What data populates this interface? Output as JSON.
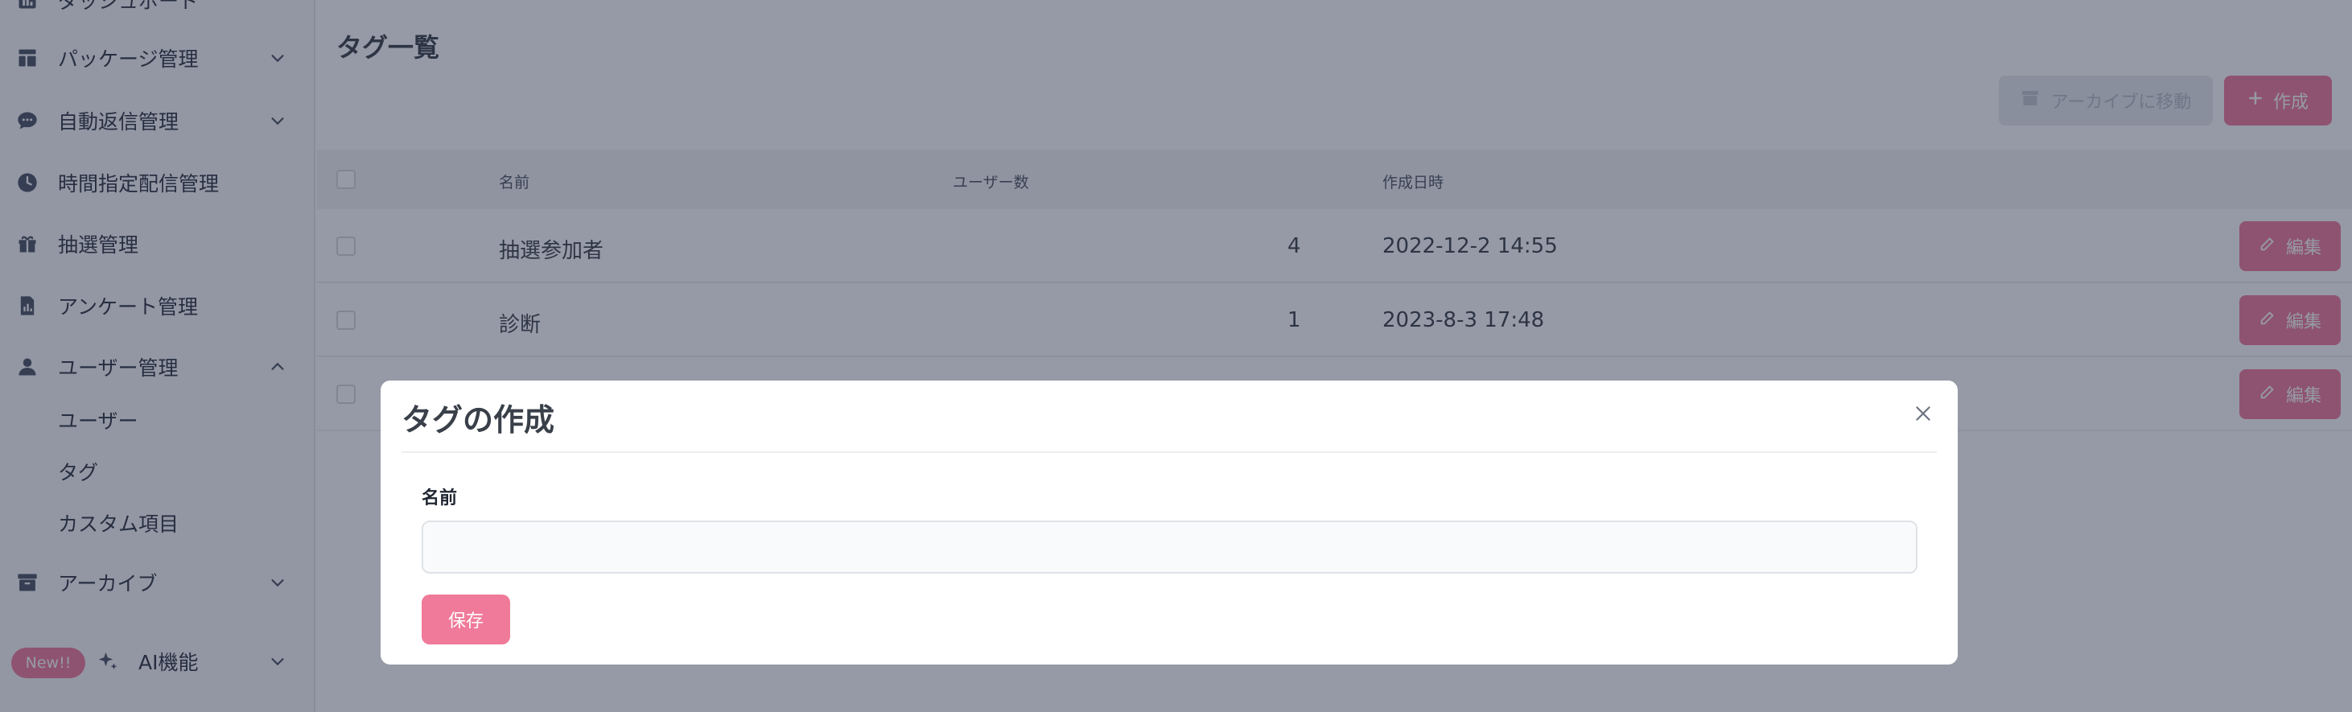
{
  "sidebar": {
    "items": [
      {
        "label": "ダッシュボード",
        "icon": "chart-icon"
      },
      {
        "label": "パッケージ管理",
        "icon": "layout-icon"
      },
      {
        "label": "自動返信管理",
        "icon": "chat-bubble-icon"
      },
      {
        "label": "時間指定配信管理",
        "icon": "clock-icon"
      },
      {
        "label": "抽選管理",
        "icon": "gift-icon"
      },
      {
        "label": "アンケート管理",
        "icon": "survey-icon"
      },
      {
        "label": "ユーザー管理",
        "icon": "user-icon"
      },
      {
        "label": "アーカイブ",
        "icon": "archive-icon"
      },
      {
        "label": "AI機能",
        "icon": "sparkle-icon"
      }
    ],
    "user_sub_items": [
      "ユーザー",
      "タグ",
      "カスタム項目"
    ],
    "new_badge": "New!!"
  },
  "main": {
    "title": "タグ一覧",
    "archive_button": "アーカイブに移動",
    "create_button": "作成",
    "table": {
      "headers": [
        "名前",
        "ユーザー数",
        "作成日時"
      ],
      "rows": [
        {
          "name": "抽選参加者",
          "users": "4",
          "created": "2022-12-2 14:55"
        },
        {
          "name": "診断",
          "users": "1",
          "created": "2023-8-3 17:48"
        }
      ],
      "edit_label": "編集"
    }
  },
  "modal": {
    "title": "タグの作成",
    "field_label": "名前",
    "field_value": "",
    "save_button": "保存"
  },
  "colors": {
    "accent": "#f07a99",
    "overlay": "#1f2942"
  }
}
